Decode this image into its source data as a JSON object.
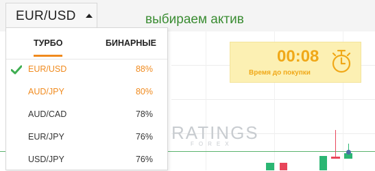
{
  "asset_selector": {
    "value": "EUR/USD"
  },
  "hint": "выбираем актив",
  "dropdown": {
    "tabs": [
      {
        "label": "ТУРБО",
        "active": true
      },
      {
        "label": "БИНАРНЫЕ",
        "active": false
      }
    ],
    "items": [
      {
        "name": "EUR/USD",
        "pct": "88%",
        "selected": true,
        "highlight": true
      },
      {
        "name": "AUD/JPY",
        "pct": "80%",
        "selected": false,
        "highlight": true
      },
      {
        "name": "AUD/CAD",
        "pct": "78%",
        "selected": false,
        "highlight": false
      },
      {
        "name": "EUR/JPY",
        "pct": "76%",
        "selected": false,
        "highlight": false
      },
      {
        "name": "USD/JPY",
        "pct": "76%",
        "selected": false,
        "highlight": false
      }
    ]
  },
  "timer": {
    "time": "00:08",
    "caption": "Время до покупки"
  },
  "watermark": {
    "brand": "RATINGS",
    "sub": "FOREX",
    "letter": "R"
  },
  "colors": {
    "accent": "#f08a1d",
    "check": "#3fae52",
    "timer_text": "#f0a818",
    "timer_bg": "#fcf0b3",
    "hint": "#3a8c32",
    "candle_up": "#2bb673",
    "candle_down": "#e8455a"
  },
  "icons": {
    "selected": "check-icon",
    "timer": "stopwatch-icon",
    "dropdown": "caret-up-icon"
  }
}
